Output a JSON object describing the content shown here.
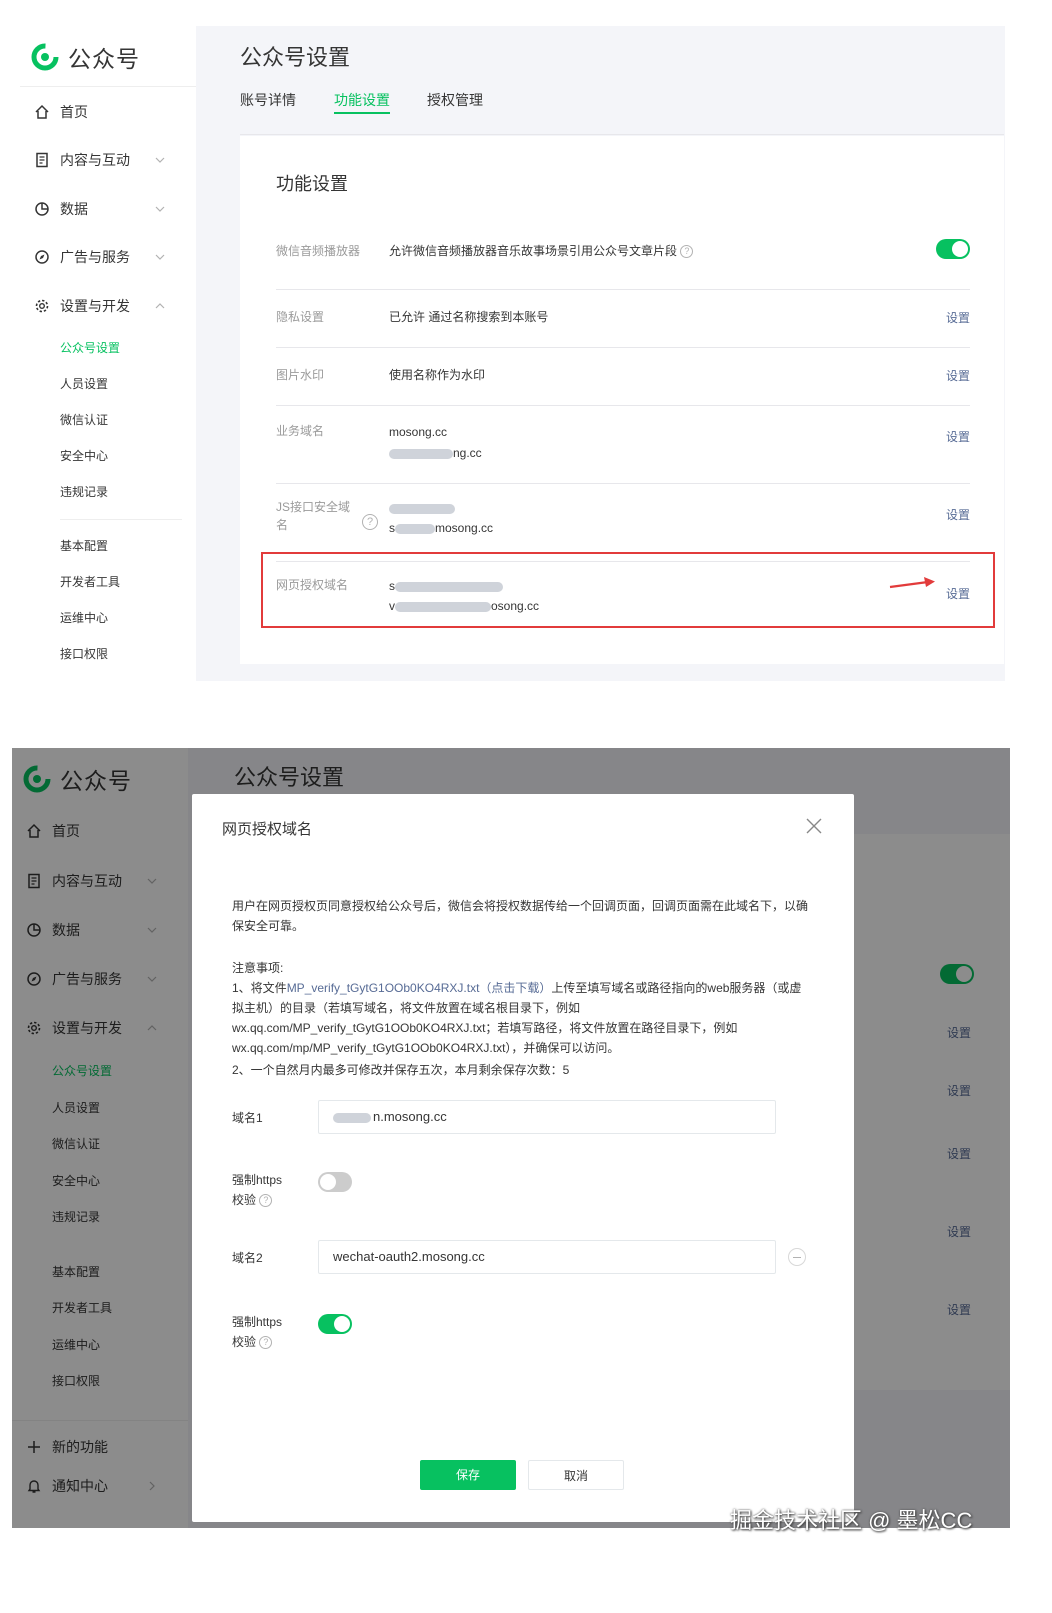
{
  "brand": {
    "name": "公众号"
  },
  "sidebar": {
    "items": [
      {
        "label": "首页"
      },
      {
        "label": "内容与互动"
      },
      {
        "label": "数据"
      },
      {
        "label": "广告与服务"
      },
      {
        "label": "设置与开发"
      }
    ],
    "subitems": [
      {
        "label": "公众号设置",
        "active": true
      },
      {
        "label": "人员设置"
      },
      {
        "label": "微信认证"
      },
      {
        "label": "安全中心"
      },
      {
        "label": "违规记录"
      },
      {
        "label": "基本配置"
      },
      {
        "label": "开发者工具"
      },
      {
        "label": "运维中心"
      },
      {
        "label": "接口权限"
      }
    ],
    "bottom": [
      {
        "label": "新的功能"
      },
      {
        "label": "通知中心"
      }
    ]
  },
  "header": {
    "title": "公众号设置",
    "tabs": [
      {
        "label": "账号详情"
      },
      {
        "label": "功能设置",
        "active": true
      },
      {
        "label": "授权管理"
      }
    ]
  },
  "settings": {
    "title": "功能设置",
    "action_label": "设置",
    "rows": [
      {
        "label": "微信音频播放器",
        "value": "允许微信音频播放器音乐故事场景引用公众号文章片段"
      },
      {
        "label": "隐私设置",
        "value": "已允许 通过名称搜索到本账号"
      },
      {
        "label": "图片水印",
        "value": "使用名称作为水印"
      },
      {
        "label": "业务域名",
        "value_1": "mosong.cc",
        "value_2": "ng.cc"
      },
      {
        "label": "JS接口安全域名",
        "value_2_prefix": "s",
        "value_2": "mosong.cc"
      },
      {
        "label": "网页授权域名",
        "value_1_prefix": "s",
        "value_2_prefix": "v",
        "value_2": "osong.cc"
      }
    ]
  },
  "modal": {
    "title": "网页授权域名",
    "intro": "用户在网页授权页同意授权给公众号后，微信会将授权数据传给一个回调页面，回调页面需在此域名下，以确保安全可靠。",
    "notes_title": "注意事项:",
    "note1_prefix": "1、将文件",
    "note1_file": "MP_verify_tGytG1OOb0KO4RXJ.txt（点击下载）",
    "note1_rest": "上传至填写域名或路径指向的web服务器（或虚拟主机）的目录（若填写域名，将文件放置在域名根目录下，例如wx.qq.com/MP_verify_tGytG1OOb0KO4RXJ.txt；若填写路径，将文件放置在路径目录下，例如wx.qq.com/mp/MP_verify_tGytG1OOb0KO4RXJ.txt），并确保可以访问。",
    "note2": "2、一个自然月内最多可修改并保存五次，本月剩余保存次数：5",
    "domain1_label": "域名1",
    "domain1_value": "n.mosong.cc",
    "https_label_1": "强制https",
    "https_label_2": "校验",
    "domain2_label": "域名2",
    "domain2_value": "wechat-oauth2.mosong.cc",
    "save_label": "保存",
    "cancel_label": "取消"
  },
  "watermark": "掘金技术社区 @ 墨松CC",
  "colors": {
    "accent": "#07c160",
    "link": "#576b95",
    "highlight": "#e23b3b"
  }
}
